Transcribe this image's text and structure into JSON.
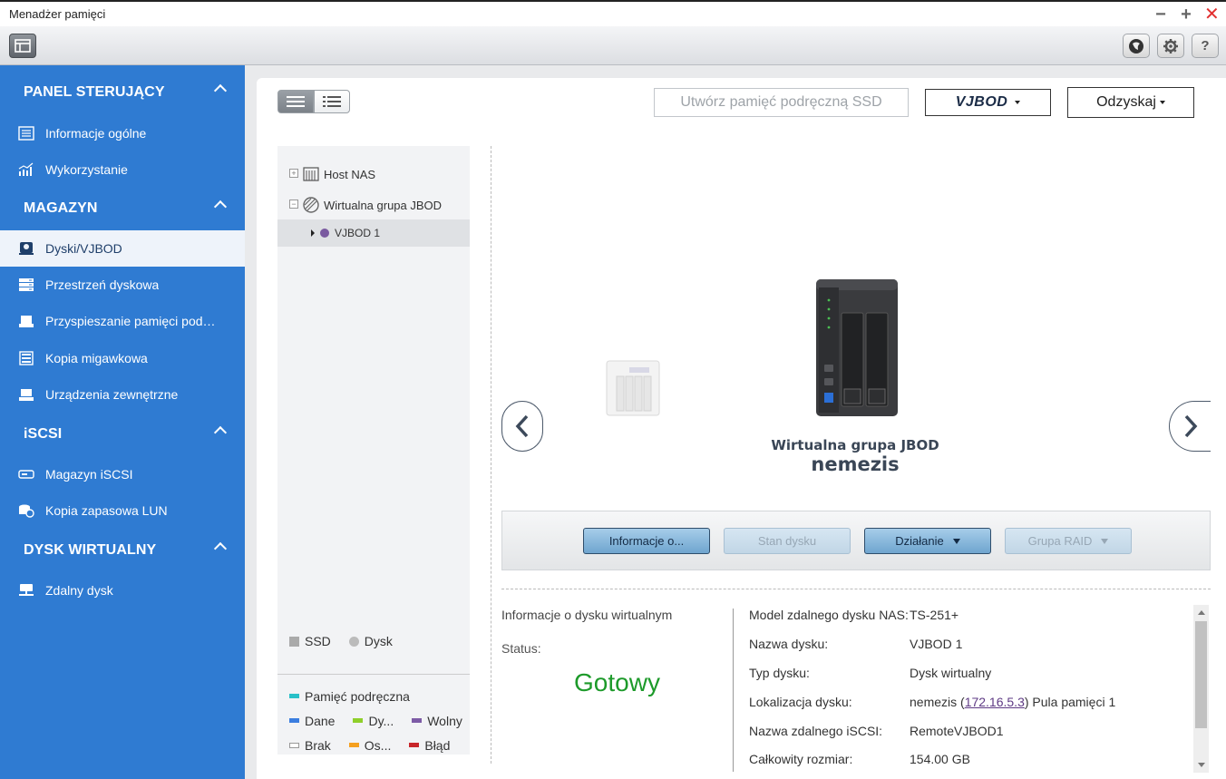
{
  "window": {
    "title": "Menadżer pamięci",
    "controls": {
      "minimize": "−",
      "maximize": "+",
      "close": "✕"
    }
  },
  "toolbar": {
    "icons": [
      "layout-icon",
      "qfinder-icon",
      "settings-icon",
      "help-icon"
    ],
    "help_label": "?"
  },
  "sidebar": {
    "sections": [
      {
        "title": "PANEL STERUJĄCY",
        "items": [
          {
            "label": "Informacje ogólne",
            "icon": "list-icon"
          },
          {
            "label": "Wykorzystanie",
            "icon": "chart-icon"
          }
        ]
      },
      {
        "title": "MAGAZYN",
        "items": [
          {
            "label": "Dyski/VJBOD",
            "icon": "disk-icon",
            "active": true
          },
          {
            "label": "Przestrzeń dyskowa",
            "icon": "storage-icon"
          },
          {
            "label": "Przyspieszanie pamięci podręcznej",
            "icon": "cache-icon"
          },
          {
            "label": "Kopia migawkowa",
            "icon": "snapshot-icon"
          },
          {
            "label": "Urządzenia zewnętrzne",
            "icon": "external-icon"
          }
        ]
      },
      {
        "title": "iSCSI",
        "items": [
          {
            "label": "Magazyn iSCSI",
            "icon": "iscsi-icon"
          },
          {
            "label": "Kopia zapasowa LUN",
            "icon": "lun-backup-icon"
          }
        ]
      },
      {
        "title": "DYSK WIRTUALNY",
        "items": [
          {
            "label": "Zdalny dysk",
            "icon": "remote-disk-icon"
          }
        ]
      }
    ]
  },
  "header_buttons": {
    "ssd_cache": "Utwórz pamięć podręczną SSD",
    "vjbod": "VJBOD",
    "recover": "Odzyskaj"
  },
  "tree": {
    "items": [
      {
        "label": "Host NAS",
        "expander": "+"
      },
      {
        "label": "Wirtualna grupa JBOD",
        "expander": "−"
      },
      {
        "label": "VJBOD 1"
      }
    ],
    "legend_top": {
      "ssd": "SSD",
      "disk": "Dysk"
    },
    "legend_bottom": {
      "cache": "Pamięć podręczna",
      "data": "Dane",
      "dy": "Dy...",
      "free": "Wolny",
      "none": "Brak",
      "os": "Os...",
      "error": "Błąd"
    },
    "colors": {
      "cache": "#29c0c8",
      "data": "#3b7ee0",
      "dy": "#8fcf2a",
      "free": "#7d5ba6",
      "none": "#ffffff",
      "os": "#f5a020",
      "error": "#c8262a",
      "vjbod_dot": "#7a5aa0"
    }
  },
  "device": {
    "group_label": "Wirtualna grupa JBOD",
    "name": "nemezis"
  },
  "actions": {
    "info": "Informacje o...",
    "disk_state": "Stan dysku",
    "action": "Działanie",
    "raid_group": "Grupa RAID"
  },
  "details": {
    "left_title": "Informacje o dysku wirtualnym",
    "status_label": "Status:",
    "status_value": "Gotowy",
    "rows": [
      {
        "key": "Model zdalnego dysku NAS:",
        "value": "TS-251+"
      },
      {
        "key": "Nazwa dysku:",
        "value": "VJBOD 1"
      },
      {
        "key": "Typ dysku:",
        "value": "Dysk wirtualny"
      },
      {
        "key": "Lokalizacja dysku:",
        "value_prefix": "nemezis (",
        "value_link": "172.16.5.3",
        "value_suffix": ") Pula pamięci 1"
      },
      {
        "key": "Nazwa zdalnego iSCSI:",
        "value": "RemoteVJBOD1"
      },
      {
        "key": "Całkowity rozmiar:",
        "value": "154.00 GB"
      }
    ]
  }
}
